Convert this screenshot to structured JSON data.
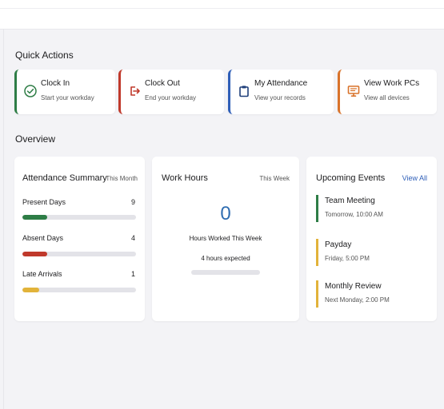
{
  "colors": {
    "green": "#2e7d46",
    "red": "#c0392b",
    "blue": "#2f5fb8",
    "orange": "#d9732b",
    "yellow": "#e2b33a",
    "big_number": "#2f6db1"
  },
  "quick_actions": {
    "title": "Quick Actions",
    "items": [
      {
        "title": "Clock In",
        "subtitle": "Start your workday",
        "icon": "check-circle-icon",
        "color": "#2e7d46"
      },
      {
        "title": "Clock Out",
        "subtitle": "End your workday",
        "icon": "logout-icon",
        "color": "#c0392b"
      },
      {
        "title": "My Attendance",
        "subtitle": "View your records",
        "icon": "clipboard-icon",
        "color": "#2f5fb8"
      },
      {
        "title": "View Work PCs",
        "subtitle": "View all devices",
        "icon": "monitor-icon",
        "color": "#d9732b"
      }
    ]
  },
  "overview": {
    "title": "Overview",
    "attendance": {
      "title": "Attendance Summary",
      "period": "This Month",
      "stats": [
        {
          "label": "Present Days",
          "value": "9",
          "fill": 0.22,
          "color": "#2e7d46"
        },
        {
          "label": "Absent Days",
          "value": "4",
          "fill": 0.22,
          "color": "#c0392b"
        },
        {
          "label": "Late Arrivals",
          "value": "1",
          "fill": 0.15,
          "color": "#e2b33a"
        }
      ]
    },
    "work_hours": {
      "title": "Work Hours",
      "period": "This Week",
      "value": "0",
      "caption": "Hours Worked This Week",
      "expected": "4 hours expected",
      "progress": 0
    },
    "events": {
      "title": "Upcoming Events",
      "view_all": "View All",
      "items": [
        {
          "title": "Team Meeting",
          "time": "Tomorrow, 10:00 AM",
          "color": "#2e7d46"
        },
        {
          "title": "Payday",
          "time": "Friday, 5:00 PM",
          "color": "#e2b33a"
        },
        {
          "title": "Monthly Review",
          "time": "Next Monday, 2:00 PM",
          "color": "#e2b33a"
        }
      ]
    }
  }
}
